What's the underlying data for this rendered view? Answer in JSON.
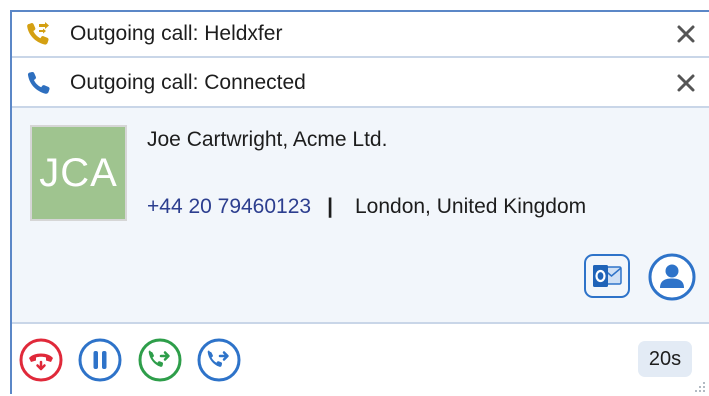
{
  "calls": [
    {
      "status_text": "Outgoing call: Heldxfer",
      "icon": "phone-transfer-icon",
      "icon_color": "#d4a012"
    },
    {
      "status_text": "Outgoing call: Connected",
      "icon": "phone-icon",
      "icon_color": "#2e6fbf"
    }
  ],
  "contact": {
    "initials": "JCA",
    "name": "Joe Cartwright, Acme Ltd.",
    "phone": "+44 20 79460123",
    "separator": "|",
    "location": "London, United Kingdom",
    "avatar_color": "#9fc48f"
  },
  "actions": {
    "hangup_icon": "hang-up-icon",
    "hold_icon": "pause-icon",
    "consult_transfer_icon": "consult-transfer-icon",
    "transfer_icon": "transfer-icon",
    "timer": "20s"
  },
  "colors": {
    "accent": "#2e73c9",
    "hangup": "#e0293a",
    "transfer_green": "#2e9e4a",
    "panel_bg": "#f2f6fb"
  }
}
